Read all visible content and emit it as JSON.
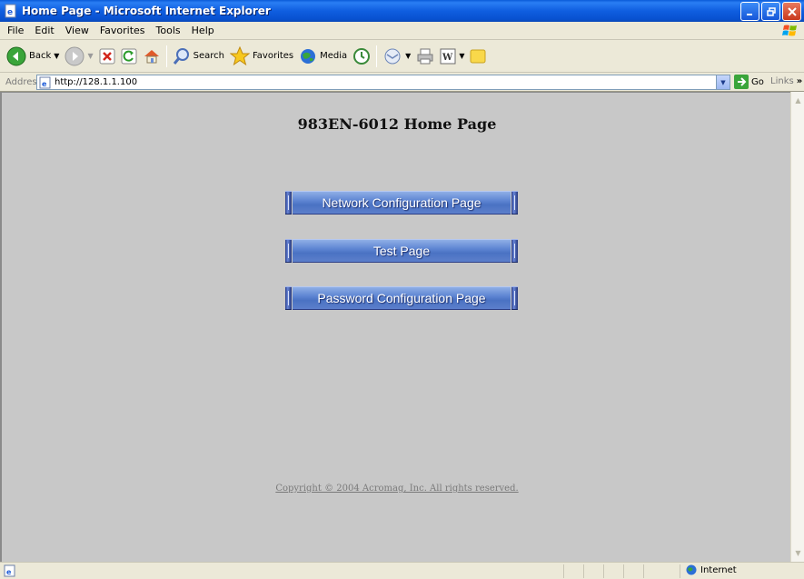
{
  "window": {
    "title": "Home Page - Microsoft Internet Explorer",
    "minimize_icon": "minimize-icon",
    "maximize_icon": "restore-icon",
    "close_icon": "close-icon"
  },
  "menu": {
    "items": [
      "File",
      "Edit",
      "View",
      "Favorites",
      "Tools",
      "Help"
    ]
  },
  "toolbar": {
    "back_label": "Back",
    "search_label": "Search",
    "favorites_label": "Favorites",
    "media_label": "Media"
  },
  "address": {
    "label": "Address",
    "value": "http://128.1.1.100",
    "go_label": "Go",
    "links_label": "Links"
  },
  "page": {
    "title": "983EN-6012 Home Page",
    "buttons": [
      {
        "label": "Network Configuration Page"
      },
      {
        "label": "Test Page"
      },
      {
        "label": "Password Configuration Page"
      }
    ],
    "copyright": "Copyright © 2004 Acromag, Inc. All rights reserved."
  },
  "status": {
    "zone_label": "Internet"
  },
  "colors": {
    "content_bg": "#c8c8c8",
    "button_face": "#5f86d3",
    "titlebar": "#0f5ee0"
  }
}
